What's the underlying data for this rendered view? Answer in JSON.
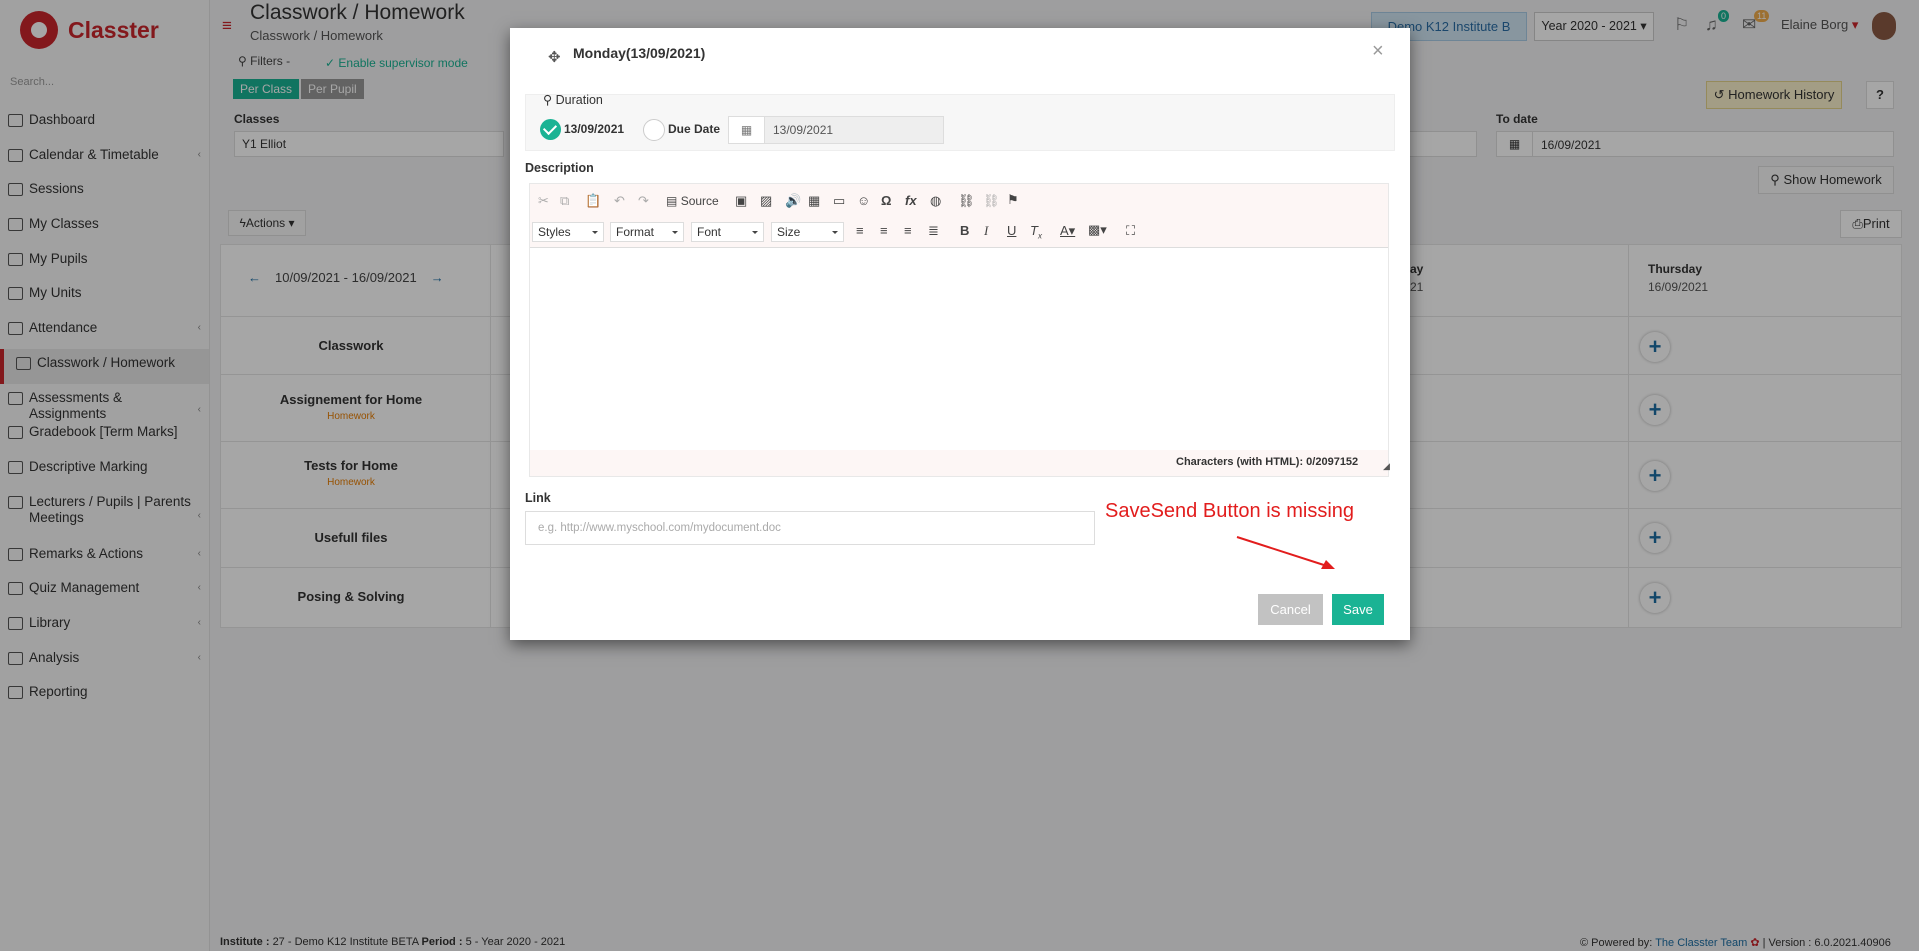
{
  "app": {
    "name": "Classter"
  },
  "sidebar": {
    "search_placeholder": "Search...",
    "items": [
      {
        "label": "Dashboard",
        "has_children": false
      },
      {
        "label": "Calendar & Timetable",
        "has_children": true
      },
      {
        "label": "Sessions",
        "has_children": false
      },
      {
        "label": "My Classes",
        "has_children": false
      },
      {
        "label": "My Pupils",
        "has_children": false
      },
      {
        "label": "My Units",
        "has_children": false
      },
      {
        "label": "Attendance",
        "has_children": true
      },
      {
        "label": "Classwork / Homework",
        "has_children": false,
        "active": true
      },
      {
        "label": "Assessments & Assignments",
        "has_children": true
      },
      {
        "label": "Gradebook [Term Marks]",
        "has_children": false
      },
      {
        "label": "Descriptive Marking",
        "has_children": false
      },
      {
        "label": "Lecturers / Pupils | Parents Meetings",
        "has_children": true
      },
      {
        "label": "Remarks & Actions",
        "has_children": true
      },
      {
        "label": "Quiz Management",
        "has_children": true
      },
      {
        "label": "Library",
        "has_children": true
      },
      {
        "label": "Analysis",
        "has_children": true
      },
      {
        "label": "Reporting",
        "has_children": false
      }
    ]
  },
  "header": {
    "title": "Classwork / Homework",
    "breadcrumb": "Classwork / Homework",
    "institute": "Demo K12 Institute B",
    "year": "Year 2020 - 2021",
    "notifications_count": "0",
    "messages_count": "11",
    "user_name": "Elaine Borg"
  },
  "filters": {
    "label": "Filters",
    "supervisor_link": "Enable supervisor mode",
    "per_class": "Per Class",
    "per_pupil": "Per Pupil",
    "classes_label": "Classes",
    "classes_value": "Y1 Elliot",
    "to_date_label": "To date",
    "to_date_value": "16/09/2021",
    "homework_history": "Homework History",
    "help": "?",
    "show_homework": "Show Homework",
    "actions": "Actions",
    "print": "Print"
  },
  "week": {
    "range": "10/09/2021 - 16/09/2021",
    "partial_day_tail": "ay",
    "partial_date_tail": "21",
    "thursday_label": "Thursday",
    "thursday_date": "16/09/2021",
    "rows": [
      {
        "label": "Classwork",
        "sub": ""
      },
      {
        "label": "Assignement for Home",
        "sub": "Homework"
      },
      {
        "label": "Tests for Home",
        "sub": "Homework"
      },
      {
        "label": "Usefull files",
        "sub": ""
      },
      {
        "label": "Posing & Solving",
        "sub": ""
      }
    ]
  },
  "footer": {
    "left_institute_label": "Institute :",
    "left_institute": "27 - Demo K12 Institute BETA",
    "left_period_label": "Period :",
    "left_period": "5 - Year 2020 - 2021",
    "powered_by": "Powered by:",
    "team": "The Classter Team",
    "version": "| Version : 6.0.2021.40906"
  },
  "modal": {
    "title": "Monday(13/09/2021)",
    "duration_label": "Duration",
    "option_date": "13/09/2021",
    "option_due": "Due Date",
    "due_date_value": "13/09/2021",
    "description_label": "Description",
    "toolbar": {
      "source": "Source",
      "styles": "Styles",
      "format": "Format",
      "font": "Font",
      "size": "Size"
    },
    "char_count": "Characters (with HTML): 0/2097152",
    "link_label": "Link",
    "link_placeholder": "e.g. http://www.myschool.com/mydocument.doc",
    "annotation": "SaveSend Button is missing",
    "cancel": "Cancel",
    "save": "Save"
  },
  "colors": {
    "brand": "#c9252c",
    "accent": "#1ab394",
    "annotation": "#e21d1d"
  }
}
